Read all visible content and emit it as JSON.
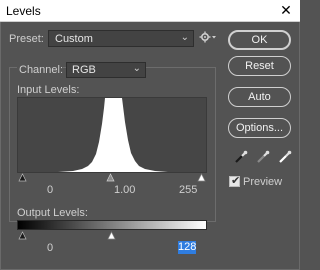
{
  "window": {
    "title": "Levels",
    "close_glyph": "✕"
  },
  "preset": {
    "label": "Preset:",
    "value": "Custom",
    "options_icon": "gear-icon"
  },
  "channel": {
    "label": "Channel:",
    "value": "RGB"
  },
  "input_levels": {
    "label": "Input Levels:",
    "black": "0",
    "gamma": "1.00",
    "white": "255"
  },
  "output_levels": {
    "label": "Output Levels:",
    "black": "0",
    "white": "128"
  },
  "buttons": {
    "ok": "OK",
    "reset": "Reset",
    "auto": "Auto",
    "options": "Options..."
  },
  "eyedroppers": [
    "black-point-eyedropper-icon",
    "gray-point-eyedropper-icon",
    "white-point-eyedropper-icon"
  ],
  "preview": {
    "label": "Preview",
    "checked": true
  },
  "colors": {
    "dialog_bg": "#535353",
    "histogram_fill": "#ffffff",
    "selected_field": "#2f7de0"
  }
}
